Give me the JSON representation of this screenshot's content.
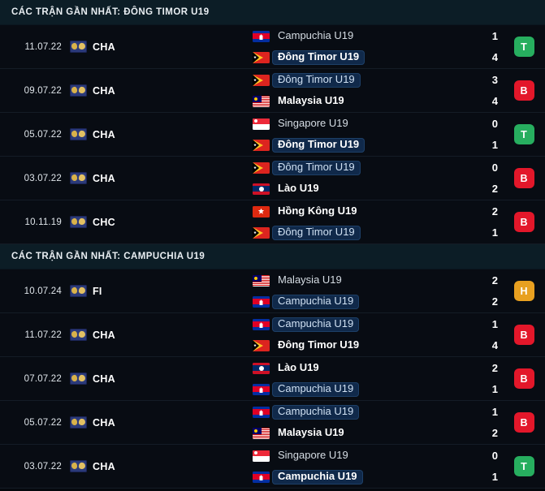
{
  "sections": [
    {
      "title": "CÁC TRẬN GẦN NHẤT: ĐÔNG TIMOR U19",
      "matches": [
        {
          "date": "11.07.22",
          "competition": "CHA",
          "competition_icon": "tournament-icon",
          "home": {
            "name": "Campuchia U19",
            "flag": "kh",
            "highlighted": false,
            "bold": false
          },
          "away": {
            "name": "Đông Timor U19",
            "flag": "tl",
            "highlighted": true,
            "bold": true
          },
          "home_score": "1",
          "away_score": "4",
          "result": "T",
          "result_color": "#27ae5f"
        },
        {
          "date": "09.07.22",
          "competition": "CHA",
          "competition_icon": "tournament-icon",
          "home": {
            "name": "Đông Timor U19",
            "flag": "tl",
            "highlighted": true,
            "bold": false
          },
          "away": {
            "name": "Malaysia U19",
            "flag": "my",
            "highlighted": false,
            "bold": true
          },
          "home_score": "3",
          "away_score": "4",
          "result": "B",
          "result_color": "#e3172a"
        },
        {
          "date": "05.07.22",
          "competition": "CHA",
          "competition_icon": "tournament-icon",
          "home": {
            "name": "Singapore U19",
            "flag": "sg",
            "highlighted": false,
            "bold": false
          },
          "away": {
            "name": "Đông Timor U19",
            "flag": "tl",
            "highlighted": true,
            "bold": true
          },
          "home_score": "0",
          "away_score": "1",
          "result": "T",
          "result_color": "#27ae5f"
        },
        {
          "date": "03.07.22",
          "competition": "CHA",
          "competition_icon": "tournament-icon",
          "home": {
            "name": "Đông Timor U19",
            "flag": "tl",
            "highlighted": true,
            "bold": false
          },
          "away": {
            "name": "Lào U19",
            "flag": "la",
            "highlighted": false,
            "bold": true
          },
          "home_score": "0",
          "away_score": "2",
          "result": "B",
          "result_color": "#e3172a"
        },
        {
          "date": "10.11.19",
          "competition": "CHC",
          "competition_icon": "tournament-icon",
          "home": {
            "name": "Hồng Kông U19",
            "flag": "hk",
            "highlighted": false,
            "bold": true
          },
          "away": {
            "name": "Đông Timor U19",
            "flag": "tl",
            "highlighted": true,
            "bold": false
          },
          "home_score": "2",
          "away_score": "1",
          "result": "B",
          "result_color": "#e3172a"
        }
      ]
    },
    {
      "title": "CÁC TRẬN GẦN NHẤT: CAMPUCHIA U19",
      "matches": [
        {
          "date": "10.07.24",
          "competition": "FI",
          "competition_icon": "tournament-icon",
          "home": {
            "name": "Malaysia U19",
            "flag": "my",
            "highlighted": false,
            "bold": false
          },
          "away": {
            "name": "Campuchia U19",
            "flag": "kh",
            "highlighted": true,
            "bold": false
          },
          "home_score": "2",
          "away_score": "2",
          "result": "H",
          "result_color": "#e8a020"
        },
        {
          "date": "11.07.22",
          "competition": "CHA",
          "competition_icon": "tournament-icon",
          "home": {
            "name": "Campuchia U19",
            "flag": "kh",
            "highlighted": true,
            "bold": false
          },
          "away": {
            "name": "Đông Timor U19",
            "flag": "tl",
            "highlighted": false,
            "bold": true
          },
          "home_score": "1",
          "away_score": "4",
          "result": "B",
          "result_color": "#e3172a"
        },
        {
          "date": "07.07.22",
          "competition": "CHA",
          "competition_icon": "tournament-icon",
          "home": {
            "name": "Lào U19",
            "flag": "la",
            "highlighted": false,
            "bold": true
          },
          "away": {
            "name": "Campuchia U19",
            "flag": "kh",
            "highlighted": true,
            "bold": false
          },
          "home_score": "2",
          "away_score": "1",
          "result": "B",
          "result_color": "#e3172a"
        },
        {
          "date": "05.07.22",
          "competition": "CHA",
          "competition_icon": "tournament-icon",
          "home": {
            "name": "Campuchia U19",
            "flag": "kh",
            "highlighted": true,
            "bold": false
          },
          "away": {
            "name": "Malaysia U19",
            "flag": "my",
            "highlighted": false,
            "bold": true
          },
          "home_score": "1",
          "away_score": "2",
          "result": "B",
          "result_color": "#e3172a"
        },
        {
          "date": "03.07.22",
          "competition": "CHA",
          "competition_icon": "tournament-icon",
          "home": {
            "name": "Singapore U19",
            "flag": "sg",
            "highlighted": false,
            "bold": false
          },
          "away": {
            "name": "Campuchia U19",
            "flag": "kh",
            "highlighted": true,
            "bold": true
          },
          "home_score": "0",
          "away_score": "1",
          "result": "T",
          "result_color": "#27ae5f"
        }
      ]
    }
  ],
  "theme": {
    "background": "#05080d",
    "row_background": "#080c13",
    "header_background": "#0c1d26",
    "divider": "#141c26",
    "highlight_background": "#10294a",
    "text_primary": "#ffffff",
    "text_secondary": "#d6dde4",
    "win_color": "#27ae5f",
    "loss_color": "#e3172a",
    "draw_color": "#e8a020"
  }
}
